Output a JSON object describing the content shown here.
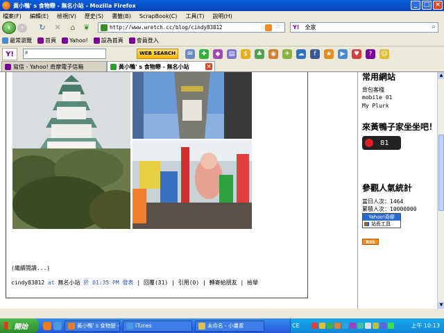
{
  "window": {
    "title": "黃小鴨' s 食物戀 - 無名小站 - Mozilla Firefox",
    "minimize": "_",
    "maximize": "□",
    "close": "×"
  },
  "menu": [
    "檔案(F)",
    "編輯(E)",
    "檢視(V)",
    "歷史(S)",
    "書籤(B)",
    "ScrapBook(C)",
    "工具(T)",
    "說明(H)"
  ],
  "nav": {
    "url": "http://www.wretch.cc/blog/cindy83812",
    "search_value": "全家",
    "search_engine_icon": "Y!"
  },
  "bookmarks": [
    {
      "label": "最常瀏覽",
      "color": "#4a8ad0"
    },
    {
      "label": "首頁",
      "color": "#7b0099"
    },
    {
      "label": "Yahoo!",
      "color": "#7b0099"
    },
    {
      "label": "設為首頁",
      "color": "#7b0099"
    },
    {
      "label": "會員登入",
      "color": "#7b0099"
    }
  ],
  "ytoolbar": {
    "logo": "Y!",
    "search_button": "WEB SEARCH"
  },
  "tabs": [
    {
      "label": "寫信 - Yahoo! 奇摩電子信箱",
      "active": false,
      "color": "#7b0099"
    },
    {
      "label": "黃小鴨' s 食物戀 - 無名小站",
      "active": true,
      "color": "#2aa02a"
    }
  ],
  "post": {
    "continue": "(繼續閱讀...)",
    "author": "cindy83812",
    "at": "at",
    "blog": "無名小站",
    "time_prefix": "於",
    "time": "01:35 PM",
    "publish": "發表",
    "reply": "回覆(31)",
    "cite": "引用(0)",
    "forward": "轉寄給朋友",
    "report": "檢舉"
  },
  "sidebar": {
    "heading1": "常用網站",
    "links": [
      "背包客棧",
      "mobile 01",
      "My Plurk"
    ],
    "heading2": "來黃鴨子家坐坐吧！",
    "counter": "81",
    "heading3": "參觀人氣統計",
    "today": "當日人次：1464",
    "total": "累積人次：10000000",
    "widget_top": "Yahoo!奇摩",
    "widget_bottom": "站長工具",
    "rss": "RSS"
  },
  "taskbar": {
    "start": "開始",
    "tasks": [
      {
        "label": "黃小鴨' s 食物戀 - ...",
        "color": "#f07a1e"
      },
      {
        "label": "iTunes",
        "color": "#4a9ae0"
      },
      {
        "label": "未命名 - 小畫家",
        "color": "#e0c04a"
      }
    ],
    "ime": "CE",
    "clock": "上午 10:13"
  }
}
